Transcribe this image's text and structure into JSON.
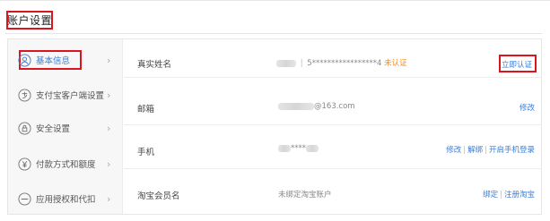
{
  "page": {
    "title": "账户设置"
  },
  "sidebar": {
    "items": [
      {
        "label": "基本信息",
        "icon": "user-icon",
        "active": true
      },
      {
        "label": "支付宝客户端设置",
        "icon": "alipay-icon"
      },
      {
        "label": "安全设置",
        "icon": "shield-lock-icon"
      },
      {
        "label": "付款方式和额度",
        "icon": "yuan-icon"
      },
      {
        "label": "应用授权和代扣",
        "icon": "block-icon"
      }
    ],
    "chevron": "›"
  },
  "rows": [
    {
      "label": "真实姓名",
      "value_masked": "5*****************4",
      "status": "未认证",
      "action": "立即认证"
    },
    {
      "label": "邮箱",
      "value_suffix": "@163.com",
      "action": "修改"
    },
    {
      "label": "手机",
      "value_masked": "****",
      "actions": [
        "修改",
        "解绑",
        "开启手机登录"
      ]
    },
    {
      "label": "淘宝会员名",
      "value": "未绑定淘宝账户",
      "actions": [
        "绑定",
        "注册淘宝"
      ]
    }
  ],
  "colors": {
    "accent": "#3b7dd8",
    "highlight": "#d9161f",
    "warning": "#f08a24"
  }
}
